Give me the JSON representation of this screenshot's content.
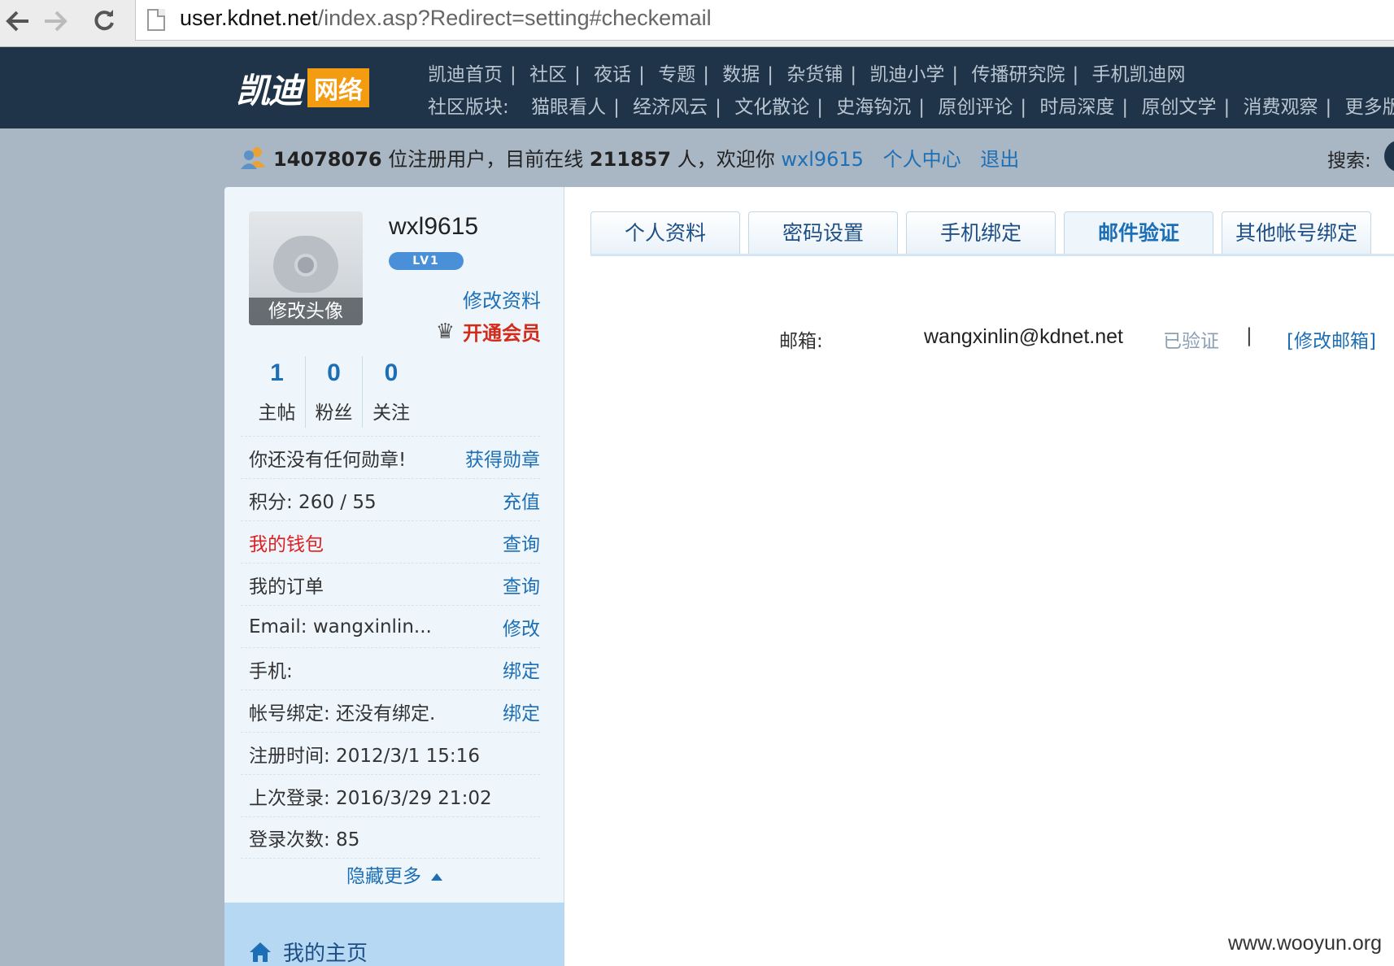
{
  "browser": {
    "url_host": "user.kdnet.net",
    "url_path": "/index.asp?Redirect=setting#checkemail"
  },
  "site": {
    "logo_text": "凯迪",
    "logo_box_text": "网络",
    "nav_row1": [
      "凯迪首页",
      "社区",
      "夜话",
      "专题",
      "数据",
      "杂货铺",
      "凯迪小学",
      "传播研究院",
      "手机凯迪网"
    ],
    "nav_row2_lead": "社区版块:",
    "nav_row2": [
      "猫眼看人",
      "经济风云",
      "文化散论",
      "史海钩沉",
      "原创评论",
      "时局深度",
      "原创文学",
      "消费观察",
      "更多版"
    ]
  },
  "stats": {
    "registered_count": "14078076",
    "text_registered": "位注册用户，目前在线",
    "online_count": "211857",
    "text_welcome": "人，欢迎你",
    "username": "wxl9615",
    "center_link": "个人中心",
    "logout_link": "退出",
    "search_label": "搜索:"
  },
  "profile": {
    "avatar_edit": "修改头像",
    "username": "wxl9615",
    "level": "LV1",
    "edit_profile": "修改资料",
    "vip_link": "开通会员",
    "counts": [
      {
        "num": "1",
        "label": "主帖"
      },
      {
        "num": "0",
        "label": "粉丝"
      },
      {
        "num": "0",
        "label": "关注"
      }
    ],
    "medal_text": "你还没有任何勋章!",
    "medal_link": "获得勋章",
    "points_text": "积分: 260 / 55",
    "points_link": "充值",
    "wallet_text": "我的钱包",
    "wallet_link": "查询",
    "order_text": "我的订单",
    "order_link": "查询",
    "email_text": "Email: wangxinlin...",
    "email_link": "修改",
    "phone_text": "手机:",
    "phone_link": "绑定",
    "account_text": "帐号绑定:  还没有绑定.",
    "account_link": "绑定",
    "reg_time": "注册时间: 2012/3/1 15:16",
    "last_login": "上次登录: 2016/3/29 21:02",
    "login_count": "登录次数: 85",
    "hide_more": "隐藏更多",
    "home_link": "我的主页"
  },
  "tabs": [
    "个人资料",
    "密码设置",
    "手机绑定",
    "邮件验证",
    "其他帐号绑定"
  ],
  "active_tab": 3,
  "email_section": {
    "label": "邮箱:",
    "value": "wangxinlin@kdnet.net",
    "status": "已验证",
    "separator": "|",
    "change_link": "[修改邮箱]"
  },
  "watermark": "www.wooyun.org",
  "colors": {
    "header_bg": "#1f3448",
    "link_blue": "#1d6fb5",
    "logo_orange": "#f39c12",
    "vip_red": "#d42a1a"
  }
}
